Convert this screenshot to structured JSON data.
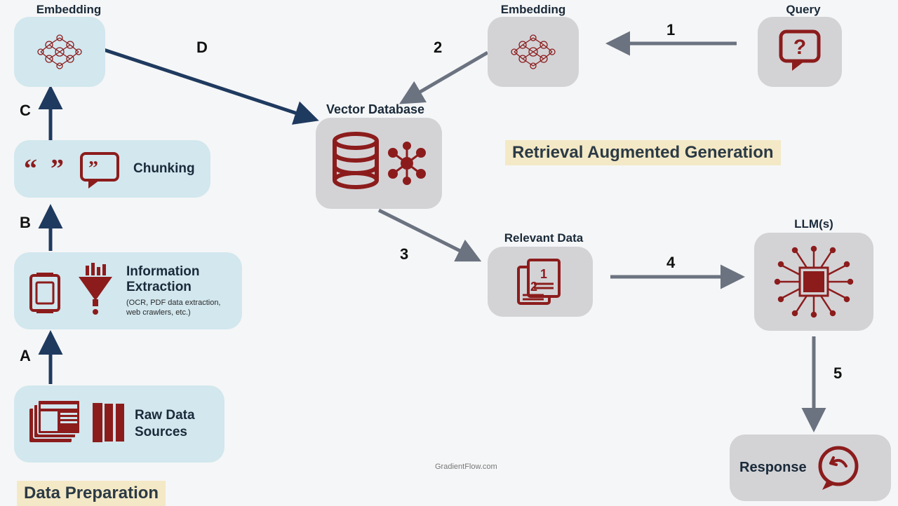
{
  "sections": {
    "data_prep": "Data Preparation",
    "rag": "Retrieval Augmented Generation"
  },
  "nodes": {
    "embedding_left": "Embedding",
    "chunking": "Chunking",
    "info_extract": "Information Extraction",
    "info_extract_sub": "(OCR, PDF data extraction, web crawlers, etc.)",
    "raw_sources": "Raw Data Sources",
    "vector_db": "Vector Database",
    "embedding_right": "Embedding",
    "query": "Query",
    "relevant_data": "Relevant Data",
    "llms": "LLM(s)",
    "response": "Response"
  },
  "steps": {
    "A": "A",
    "B": "B",
    "C": "C",
    "D": "D",
    "1": "1",
    "2": "2",
    "3": "3",
    "4": "4",
    "5": "5"
  },
  "credit": "GradientFlow.com",
  "colors": {
    "blue_node": "#d2e7ee",
    "gray_node": "#d3d3d6",
    "highlight": "#f4e9c6",
    "icon_maroon": "#8c1c1c",
    "arrow_navy": "#1f3a5f",
    "arrow_gray": "#6b7280"
  }
}
